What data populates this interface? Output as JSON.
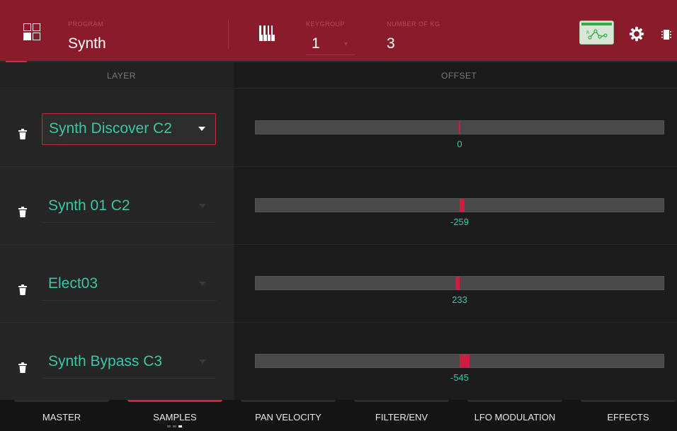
{
  "header": {
    "program_label": "PROGRAM",
    "program_value": "Synth",
    "keygroup_label": "KEYGROUP",
    "keygroup_value": "1",
    "num_kg_label": "NUMBER OF KG",
    "num_kg_value": "3",
    "icons": [
      "grid-icon",
      "piano-keyboard-icon",
      "rack-icon",
      "gear-icon",
      "chip-icon"
    ],
    "colors": {
      "bar": "#8a1b2b",
      "accent": "#d7263d"
    }
  },
  "columns": {
    "layer": "LAYER",
    "offset": "OFFSET"
  },
  "layers": [
    {
      "sample": "Synth Discover C2",
      "offset": "0",
      "offset_value": 0,
      "selected": true
    },
    {
      "sample": "Synth 01 C2",
      "offset": "-259",
      "offset_value": -259,
      "selected": false
    },
    {
      "sample": "Elect03",
      "offset": "233",
      "offset_value": 233,
      "selected": false
    },
    {
      "sample": "Synth Bypass C3",
      "offset": "-545",
      "offset_value": -545,
      "selected": false
    }
  ],
  "tabs": [
    {
      "label": "MASTER",
      "active": false
    },
    {
      "label": "SAMPLES",
      "active": true
    },
    {
      "label": "PAN VELOCITY",
      "active": false
    },
    {
      "label": "FILTER/ENV",
      "active": false
    },
    {
      "label": "LFO MODULATION",
      "active": false
    },
    {
      "label": "EFFECTS",
      "active": false
    }
  ],
  "pager": {
    "pages": 3,
    "current": 3
  },
  "colors": {
    "value_text": "#3bc7a5",
    "marker": "#d01b42"
  }
}
